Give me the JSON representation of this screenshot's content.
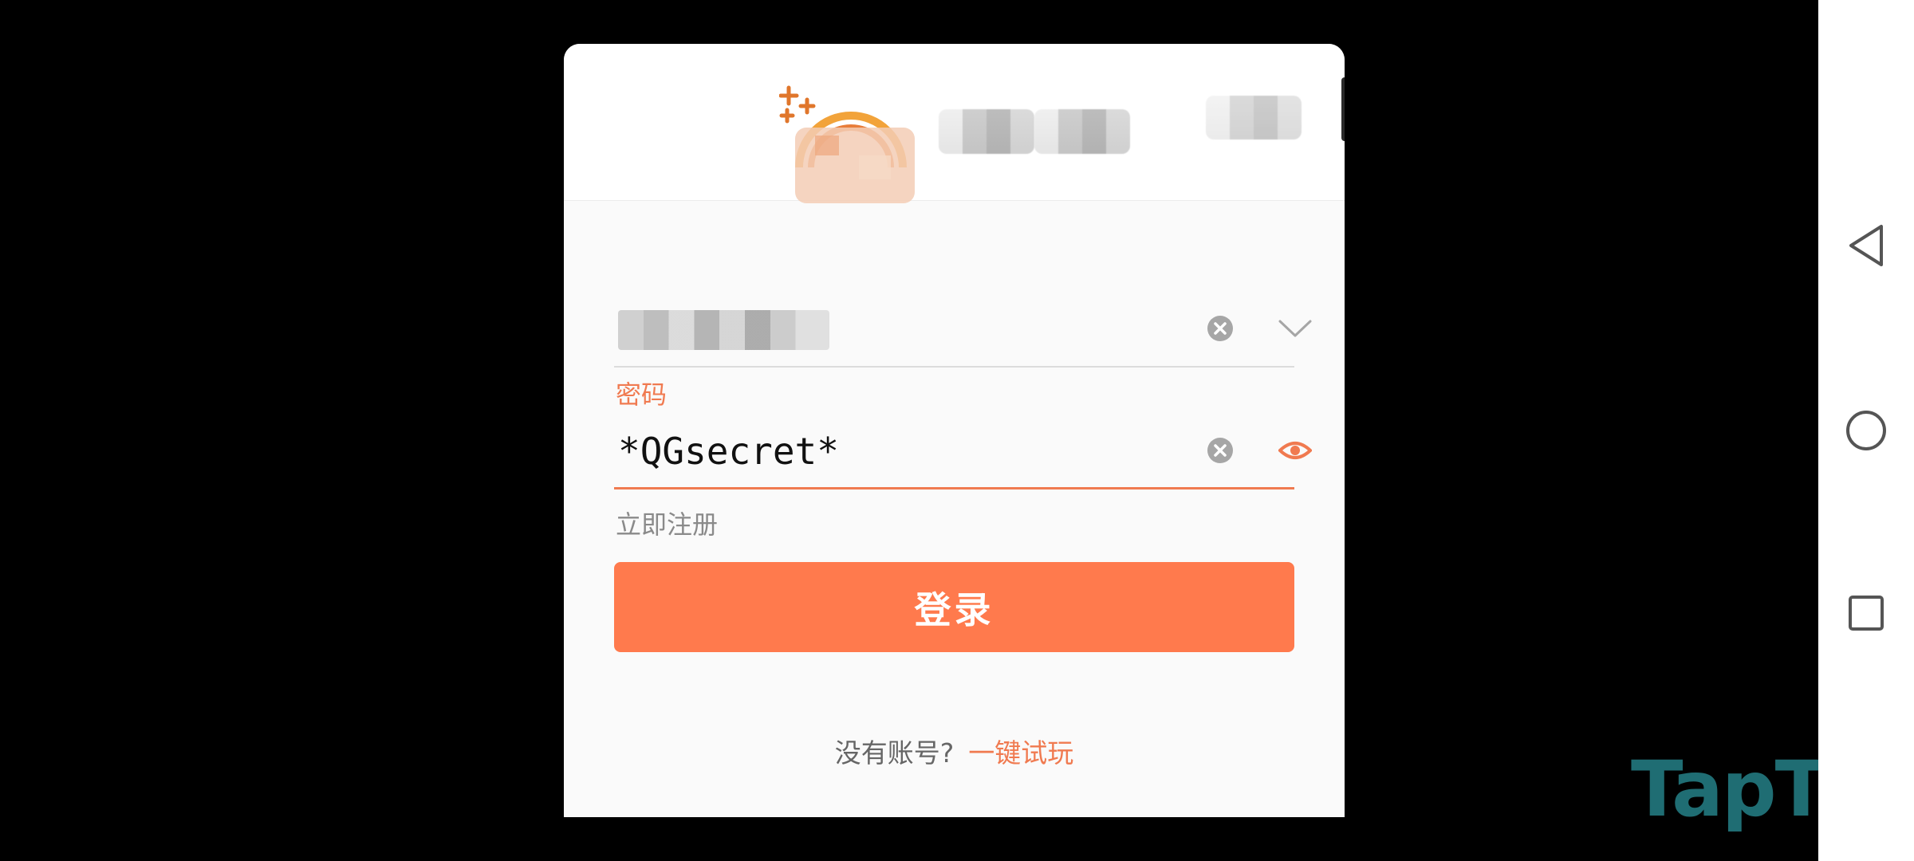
{
  "dialog": {
    "account": {
      "value": ""
    },
    "password": {
      "label": "密码",
      "value": "*QGsecret*"
    },
    "register_link": "立即注册",
    "login_button": "登录",
    "footer": {
      "prompt": "没有账号?",
      "trial_link": "一键试玩"
    }
  },
  "watermark": {
    "text": "TapTap"
  },
  "colors": {
    "accent": "#ff7a4d",
    "accent_text": "#f07a50",
    "muted_text": "#8a8a8a",
    "background": "#000000",
    "dialog_bg": "#fafafa"
  },
  "icons": {
    "account_clear": "clear-icon",
    "account_dropdown": "chevron-down-icon",
    "password_clear": "clear-icon",
    "password_visibility": "eye-icon",
    "nav_back": "back-triangle-icon",
    "nav_home": "home-circle-icon",
    "nav_recent": "recent-square-icon"
  }
}
